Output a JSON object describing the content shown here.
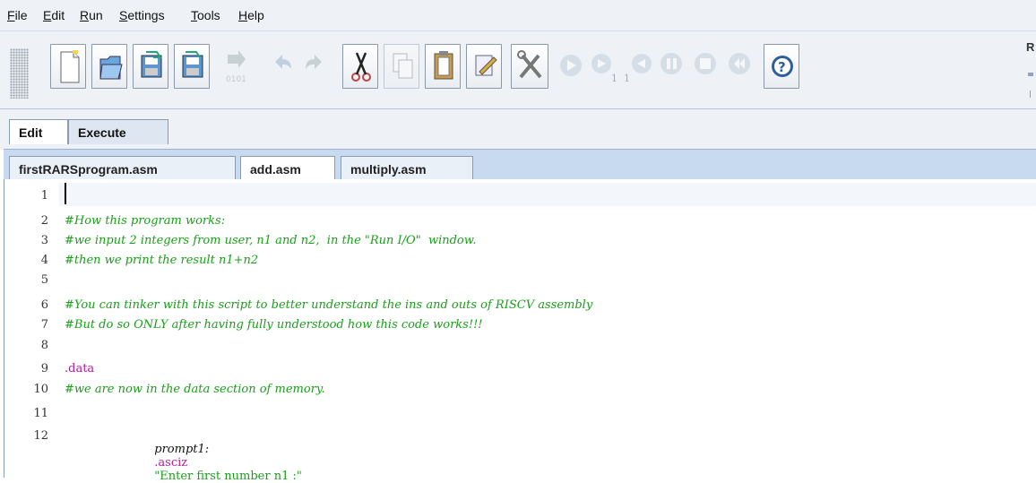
{
  "menu": [
    {
      "mn": "F",
      "rest": "ile"
    },
    {
      "mn": "E",
      "rest": "dit"
    },
    {
      "mn": "R",
      "rest": "un"
    },
    {
      "mn": "S",
      "rest": "ettings"
    },
    {
      "mn": "T",
      "rest": "ools"
    },
    {
      "mn": "H",
      "rest": "elp"
    }
  ],
  "toolbar": {
    "step_sub_1": "1",
    "step_sub_2": "1",
    "right_edge_text": "R",
    "assemble_sub": "0101"
  },
  "main_tabs": {
    "edit": "Edit",
    "execute": "Execute"
  },
  "file_tabs": [
    "firstRARSprogram.asm",
    "add.asm",
    "multiply.asm"
  ],
  "editor": {
    "line_numbers": [
      "1",
      "2",
      "3",
      "4",
      "5",
      "6",
      "7",
      "8",
      "9",
      "10",
      "11",
      "12"
    ],
    "lines": {
      "l2": "#How this program works:",
      "l3": "#we input 2 integers from user, n1 and n2,  in the \"Run I/O\"  window.",
      "l4": "#then we print the result n1+n2",
      "l6": "#You can tinker with this script to better understand the ins and outs of RISCV assembly",
      "l7": "#But do so ONLY after having fully understood how this code works!!!",
      "l9": ".data",
      "l10": "#we are now in the data section of memory.",
      "l12_label": "prompt1:",
      "l12_directive": ".asciz",
      "l12_string": "\"Enter first number n1 :\""
    }
  },
  "colors": {
    "comment": "#19a019",
    "directive": "#c0159f",
    "tab_bar": "#c8daf0"
  }
}
